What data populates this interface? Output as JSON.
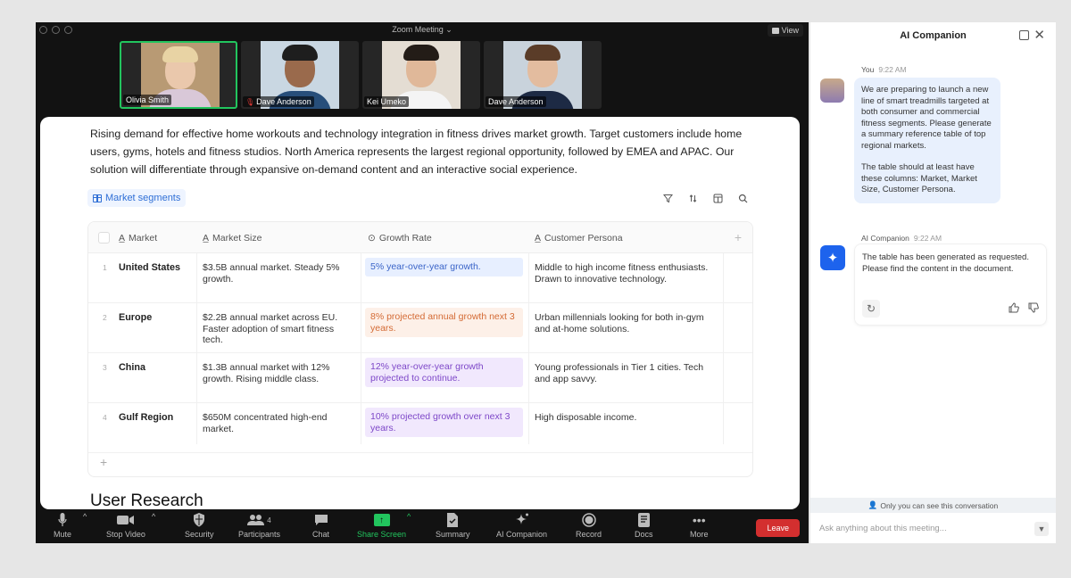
{
  "window": {
    "title": "Zoom Meeting ⌄",
    "view_label": "View"
  },
  "participants": [
    {
      "name": "Olivia Smith",
      "active": true,
      "muted": false,
      "bg": "#b89a74",
      "skin": "#eac8ac",
      "hair": "#e8d3a4",
      "shirt": "#d9c8d8"
    },
    {
      "name": "Dave Anderson",
      "active": false,
      "muted": true,
      "bg": "#c9d7e2",
      "skin": "#9a6a4c",
      "hair": "#1e1e1e",
      "shirt": "#274e7a"
    },
    {
      "name": "Kei Umeko",
      "active": false,
      "muted": false,
      "bg": "#e4ddd3",
      "skin": "#e0b899",
      "hair": "#231c17",
      "shirt": "#f4f4f4"
    },
    {
      "name": "Dave Anderson",
      "active": false,
      "muted": false,
      "bg": "#c9d3dc",
      "skin": "#e3bc9f",
      "hair": "#5a3c28",
      "shirt": "#1d2a44"
    }
  ],
  "doc": {
    "paragraph": "Rising demand for effective home workouts and technology integration in fitness drives market growth. Target customers include home users, gyms, hotels and fitness studios. North America represents the largest regional opportunity, followed by EMEA and APAC. Our solution will differentiate through expansive on-demand content and an interactive social experience.",
    "table_title": "Market segments",
    "tool_icons": [
      "filter-icon",
      "sort-icon",
      "columns-icon",
      "search-icon"
    ],
    "columns": [
      "Market",
      "Market Size",
      "Growth Rate",
      "Customer Persona"
    ],
    "rows": [
      {
        "num": "1",
        "market": "United States",
        "size": "$3.5B annual market. Steady 5% growth.",
        "growth": "5% year-over-year growth.",
        "growth_color": "blue",
        "persona": "Middle to high income fitness enthusiasts. Drawn to innovative technology."
      },
      {
        "num": "2",
        "market": "Europe",
        "size": "$2.2B annual market across EU. Faster adoption of smart fitness tech.",
        "growth": "8% projected annual growth next 3 years.",
        "growth_color": "orange",
        "persona": "Urban millennials looking for both in-gym and at-home solutions."
      },
      {
        "num": "3",
        "market": "China",
        "size": "$1.3B annual market with 12% growth. Rising middle class.",
        "growth": "12% year-over-year growth projected to continue.",
        "growth_color": "purple",
        "persona": "Young professionals in Tier 1 cities. Tech and app savvy."
      },
      {
        "num": "4",
        "market": "Gulf Region",
        "size": "$650M concentrated high-end market.",
        "growth": "10% projected growth over next 3 years.",
        "growth_color": "purple",
        "persona": "High disposable income."
      }
    ],
    "next_heading": "User Research"
  },
  "toolbar": {
    "mute": "Mute",
    "stop_video": "Stop Video",
    "security": "Security",
    "participants": "Participants",
    "participants_count": "4",
    "chat": "Chat",
    "share_screen": "Share Screen",
    "summary": "Summary",
    "ai_companion": "AI Companion",
    "record": "Record",
    "docs": "Docs",
    "more": "More",
    "leave": "Leave"
  },
  "panel": {
    "title": "AI Companion",
    "user_label": "You",
    "user_time": "9:22 AM",
    "user_msg_1": "We are preparing to launch a new line of smart treadmills targeted at both consumer and commercial fitness segments. Please generate a summary reference table of top regional markets.",
    "user_msg_2": "The table should at least have these columns: Market, Market Size, Customer Persona.",
    "ai_label": "AI Companion",
    "ai_time": "9:22 AM",
    "ai_msg": "The table has been generated as requested. Please find the content in the document.",
    "notice": "Only you can see this conversation",
    "input_placeholder": "Ask anything about this meeting..."
  }
}
